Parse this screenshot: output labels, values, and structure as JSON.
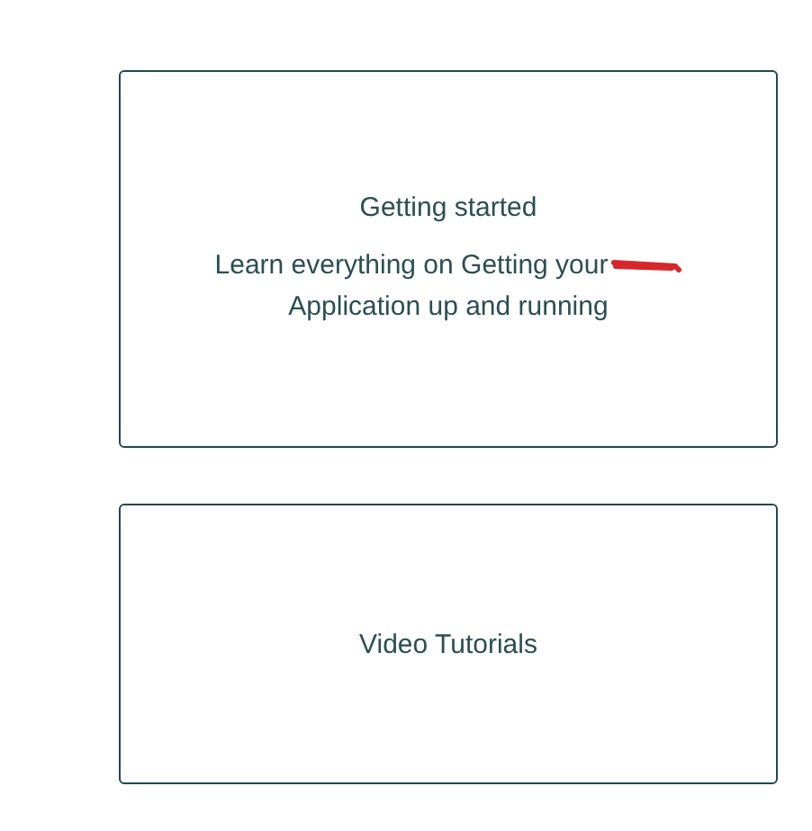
{
  "cards": [
    {
      "title": "Getting started",
      "description": [
        {
          "text": "Learn everything on Getting your",
          "redacted": true
        },
        {
          "text": "Application up and running",
          "redacted": false
        }
      ]
    },
    {
      "title": "Video Tutorials"
    }
  ]
}
